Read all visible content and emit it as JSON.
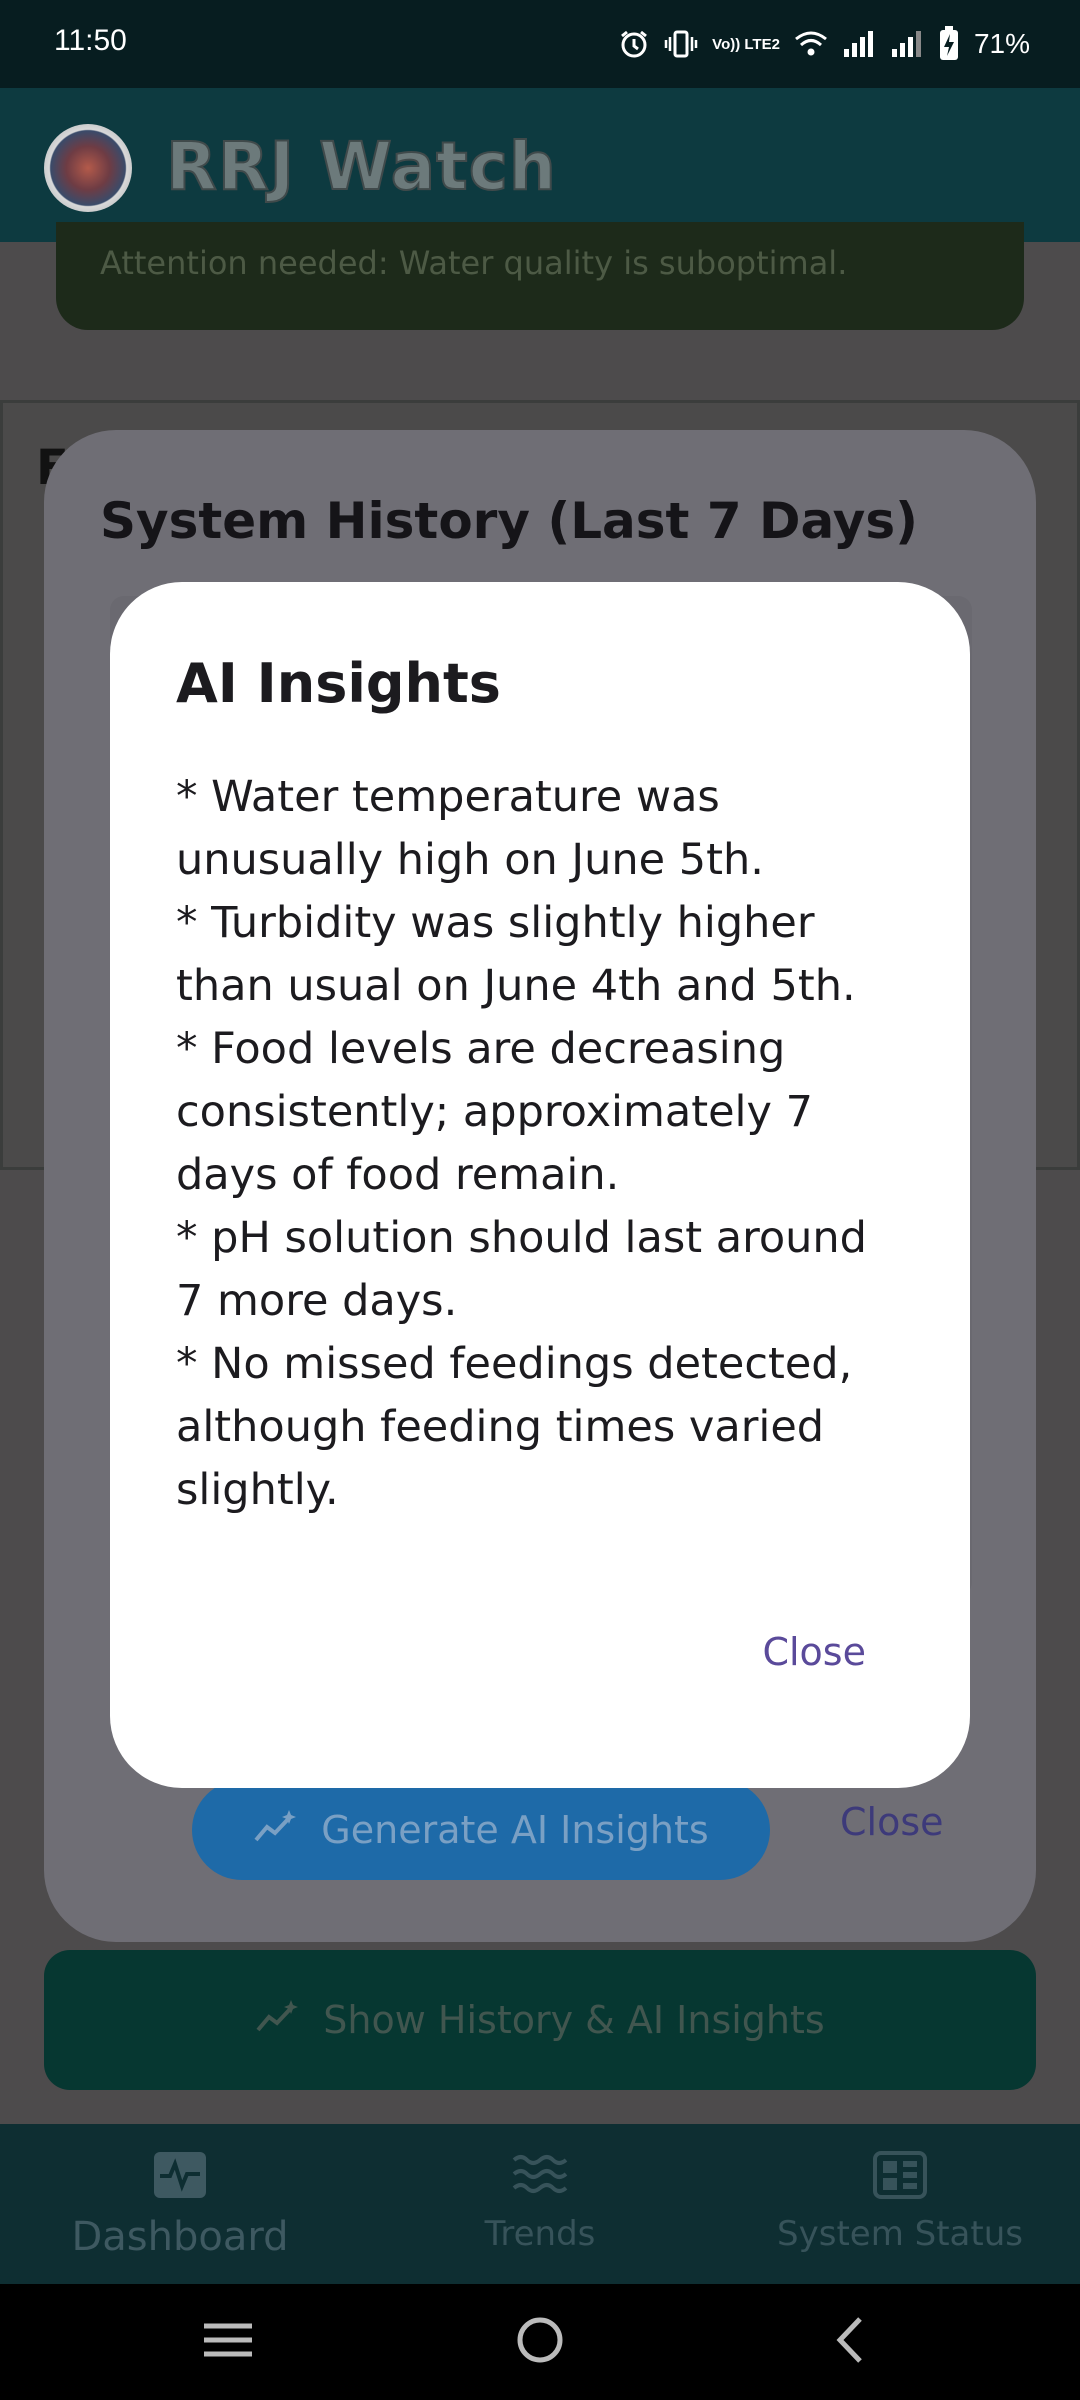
{
  "status_bar": {
    "time": "11:50",
    "network_label": "Vo)) LTE2",
    "battery": "71%"
  },
  "app": {
    "title": "RRJ Watch"
  },
  "dashboard": {
    "alert_text": "Attention needed: Water quality is suboptimal.",
    "section_initial": "F",
    "show_history_label": "Show History & AI Insights"
  },
  "history_dialog": {
    "title": "System History (Last 7 Days)",
    "generate_label": "Generate AI Insights",
    "close_label": "Close"
  },
  "ai_dialog": {
    "title": "AI Insights",
    "lines": [
      "* Water temperature was",
      "unusually high on June 5th.",
      "* Turbidity was slightly higher",
      "than usual on June 4th and 5th.",
      "* Food levels are decreasing",
      "consistently; approximately 7",
      "days of food remain.",
      "* pH solution should last around",
      "7 more days.",
      "* No missed feedings detected,",
      "although feeding times varied",
      "slightly."
    ],
    "close_label": "Close"
  },
  "bottom_nav": {
    "items": [
      {
        "label": "Dashboard",
        "icon": "activity-icon"
      },
      {
        "label": "Trends",
        "icon": "waves-icon"
      },
      {
        "label": "System Status",
        "icon": "dashboard-panel-icon"
      }
    ]
  },
  "colors": {
    "header_bg": "#0d3a40",
    "dialog_bg": "#ffffff",
    "accent_close": "#5a4a9a",
    "generate_button": "#1e6aa8"
  }
}
